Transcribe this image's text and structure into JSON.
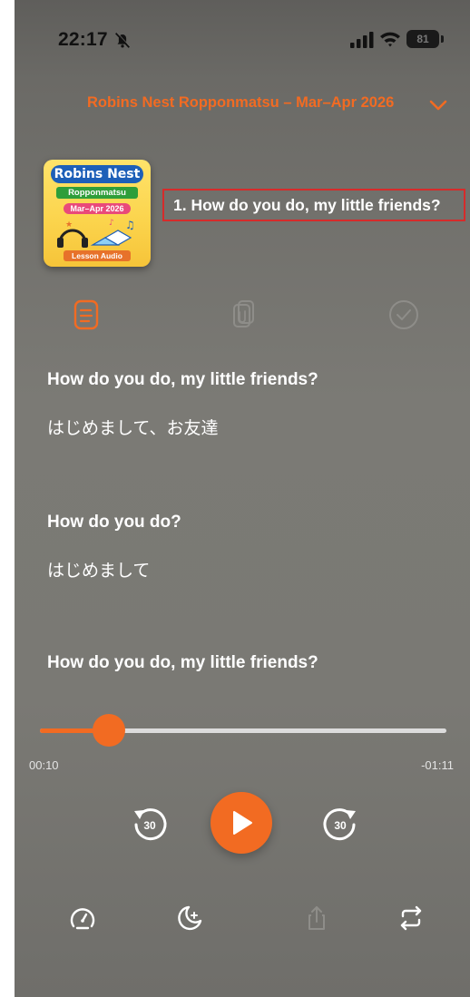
{
  "status_bar": {
    "time": "22:17",
    "battery": "81",
    "icons": [
      "bell-slash-icon",
      "signal-icon",
      "wifi-icon",
      "battery-icon"
    ]
  },
  "header": {
    "playlist_title": "Robins Nest Ropponmatsu – Mar–Apr 2026",
    "collapse_icon": "chevron-down-icon"
  },
  "cover": {
    "brand": "Robins Nest",
    "subtitle": "Ropponmatsu",
    "date": "Mar–Apr 2026",
    "badge": "Lesson Audio"
  },
  "track": {
    "title": "1. How do you do, my little friends?"
  },
  "tabs": [
    {
      "icon": "document-icon",
      "active": true
    },
    {
      "icon": "clipboard-icon",
      "active": false
    },
    {
      "icon": "check-circle-icon",
      "active": false
    }
  ],
  "lyrics": [
    {
      "en": "How do you do, my little friends?",
      "jp": "はじめまして、お友達"
    },
    {
      "en": "How do you do?",
      "jp": "はじめまして"
    },
    {
      "en": "How do you do, my little friends?",
      "jp": ""
    }
  ],
  "progress": {
    "elapsed": "00:10",
    "remaining": "-01:11",
    "fraction": 0.17
  },
  "controls": {
    "rewind_seconds": "30",
    "forward_seconds": "30",
    "play_icon": "play-icon"
  },
  "bottom_bar": [
    "speed-icon",
    "sleep-timer-icon",
    "share-icon",
    "repeat-icon"
  ],
  "colors": {
    "accent": "#f26b22",
    "highlight_box": "#d62b2b"
  }
}
